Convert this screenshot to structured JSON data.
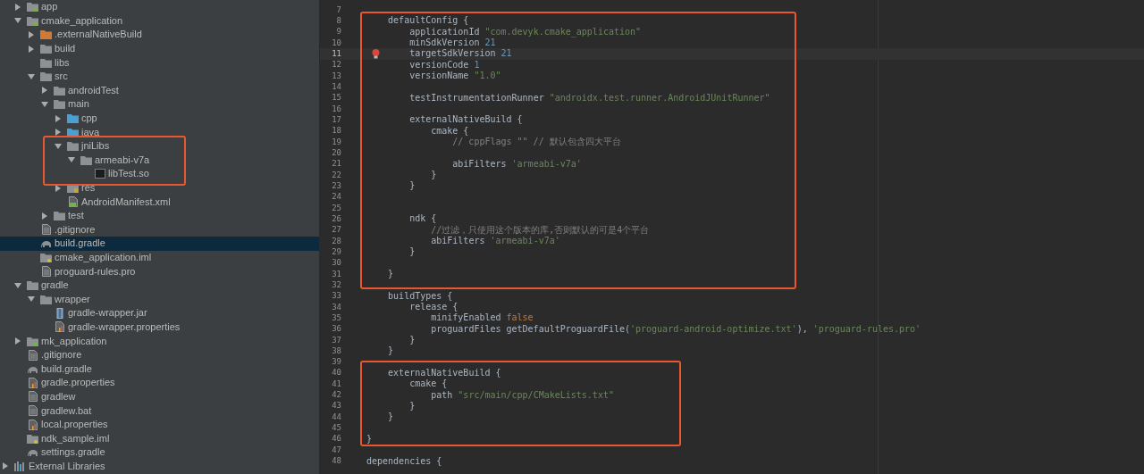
{
  "project_tree": [
    {
      "label": "app",
      "kind": "module",
      "expanded": false,
      "selected": false
    },
    {
      "label": "cmake_application",
      "kind": "module",
      "expanded": true,
      "selected": false,
      "children": [
        {
          "label": ".externalNativeBuild",
          "kind": "excluded-folder",
          "expanded": false,
          "selected": false
        },
        {
          "label": "build",
          "kind": "folder",
          "expanded": false,
          "selected": false
        },
        {
          "label": "libs",
          "kind": "folder",
          "selected": false
        },
        {
          "label": "src",
          "kind": "folder",
          "expanded": true,
          "selected": false,
          "children": [
            {
              "label": "androidTest",
              "kind": "folder",
              "expanded": false,
              "selected": false
            },
            {
              "label": "main",
              "kind": "folder",
              "expanded": true,
              "selected": false,
              "children": [
                {
                  "label": "cpp",
                  "kind": "source-folder",
                  "expanded": false,
                  "selected": false
                },
                {
                  "label": "java",
                  "kind": "source-folder",
                  "expanded": false,
                  "selected": false
                },
                {
                  "label": "jniLibs",
                  "kind": "folder",
                  "expanded": true,
                  "selected": false,
                  "children": [
                    {
                      "label": "armeabi-v7a",
                      "kind": "folder",
                      "expanded": true,
                      "selected": false,
                      "children": [
                        {
                          "label": "libTest.so",
                          "kind": "binary",
                          "selected": false
                        }
                      ]
                    }
                  ]
                },
                {
                  "label": "res",
                  "kind": "resource-folder",
                  "expanded": false,
                  "selected": false
                },
                {
                  "label": "AndroidManifest.xml",
                  "kind": "manifest",
                  "selected": false
                }
              ]
            },
            {
              "label": "test",
              "kind": "folder",
              "expanded": false,
              "selected": false
            }
          ]
        },
        {
          "label": ".gitignore",
          "kind": "file",
          "selected": false
        },
        {
          "label": "build.gradle",
          "kind": "gradle",
          "selected": true
        },
        {
          "label": "cmake_application.iml",
          "kind": "iml",
          "selected": false
        },
        {
          "label": "proguard-rules.pro",
          "kind": "file",
          "selected": false
        }
      ]
    },
    {
      "label": "gradle",
      "kind": "folder",
      "expanded": true,
      "selected": false,
      "children": [
        {
          "label": "wrapper",
          "kind": "folder",
          "expanded": true,
          "selected": false,
          "children": [
            {
              "label": "gradle-wrapper.jar",
              "kind": "jar",
              "selected": false
            },
            {
              "label": "gradle-wrapper.properties",
              "kind": "properties",
              "selected": false
            }
          ]
        }
      ]
    },
    {
      "label": "mk_application",
      "kind": "module",
      "expanded": false,
      "selected": false
    },
    {
      "label": ".gitignore",
      "kind": "file",
      "selected": false
    },
    {
      "label": "build.gradle",
      "kind": "gradle",
      "selected": false
    },
    {
      "label": "gradle.properties",
      "kind": "properties",
      "selected": false
    },
    {
      "label": "gradlew",
      "kind": "file",
      "selected": false
    },
    {
      "label": "gradlew.bat",
      "kind": "file",
      "selected": false
    },
    {
      "label": "local.properties",
      "kind": "properties",
      "selected": false
    },
    {
      "label": "ndk_sample.iml",
      "kind": "iml",
      "selected": false
    },
    {
      "label": "settings.gradle",
      "kind": "gradle",
      "selected": false
    },
    {
      "label": "External Libraries",
      "kind": "library",
      "expanded": false,
      "selected": false
    }
  ],
  "editor": {
    "lines": [
      {
        "number": "7",
        "current": false
      },
      {
        "number": "8",
        "current": false,
        "tokens": [
          {
            "text": "    defaultConfig {",
            "kind": "plain"
          }
        ]
      },
      {
        "number": "9",
        "current": false,
        "tokens": [
          {
            "text": "        applicationId ",
            "kind": "plain"
          },
          {
            "text": "\"com.devyk.cmake_application\"",
            "kind": "string"
          }
        ]
      },
      {
        "number": "10",
        "current": false,
        "tokens": [
          {
            "text": "        minSdkVersion ",
            "kind": "plain"
          },
          {
            "text": "21",
            "kind": "number"
          }
        ]
      },
      {
        "number": "11",
        "current": true,
        "tokens": [
          {
            "text": "        targetSdkVersion ",
            "kind": "plain"
          },
          {
            "text": "21",
            "kind": "number"
          }
        ]
      },
      {
        "number": "12",
        "current": false,
        "tokens": [
          {
            "text": "        versionCode ",
            "kind": "plain"
          },
          {
            "text": "1",
            "kind": "number"
          }
        ]
      },
      {
        "number": "13",
        "current": false,
        "tokens": [
          {
            "text": "        versionName ",
            "kind": "plain"
          },
          {
            "text": "\"1.0\"",
            "kind": "string"
          }
        ]
      },
      {
        "number": "14",
        "current": false
      },
      {
        "number": "15",
        "current": false,
        "tokens": [
          {
            "text": "        testInstrumentationRunner ",
            "kind": "plain"
          },
          {
            "text": "\"androidx.test.runner.AndroidJUnitRunner\"",
            "kind": "string"
          }
        ]
      },
      {
        "number": "16",
        "current": false
      },
      {
        "number": "17",
        "current": false,
        "tokens": [
          {
            "text": "        externalNativeBuild {",
            "kind": "plain"
          }
        ]
      },
      {
        "number": "18",
        "current": false,
        "tokens": [
          {
            "text": "            cmake {",
            "kind": "plain"
          }
        ]
      },
      {
        "number": "19",
        "current": false,
        "tokens": [
          {
            "text": "                // cppFlags \"\" // 默认包含四大平台",
            "kind": "comment"
          }
        ]
      },
      {
        "number": "20",
        "current": false
      },
      {
        "number": "21",
        "current": false,
        "tokens": [
          {
            "text": "                abiFilters ",
            "kind": "plain"
          },
          {
            "text": "'armeabi-v7a'",
            "kind": "string"
          }
        ]
      },
      {
        "number": "22",
        "current": false,
        "tokens": [
          {
            "text": "            }",
            "kind": "plain"
          }
        ]
      },
      {
        "number": "23",
        "current": false,
        "tokens": [
          {
            "text": "        }",
            "kind": "plain"
          }
        ]
      },
      {
        "number": "24",
        "current": false
      },
      {
        "number": "25",
        "current": false
      },
      {
        "number": "26",
        "current": false,
        "tokens": [
          {
            "text": "        ndk {",
            "kind": "plain"
          }
        ]
      },
      {
        "number": "27",
        "current": false,
        "tokens": [
          {
            "text": "            //过滤，只使用这个版本的库,否则默认的可是4个平台",
            "kind": "comment"
          }
        ]
      },
      {
        "number": "28",
        "current": false,
        "tokens": [
          {
            "text": "            abiFilters ",
            "kind": "plain"
          },
          {
            "text": "'armeabi-v7a'",
            "kind": "string"
          }
        ]
      },
      {
        "number": "29",
        "current": false,
        "tokens": [
          {
            "text": "        }",
            "kind": "plain"
          }
        ]
      },
      {
        "number": "30",
        "current": false
      },
      {
        "number": "31",
        "current": false,
        "tokens": [
          {
            "text": "    }",
            "kind": "plain"
          }
        ]
      },
      {
        "number": "32",
        "current": false
      },
      {
        "number": "33",
        "current": false,
        "tokens": [
          {
            "text": "    buildTypes {",
            "kind": "plain"
          }
        ]
      },
      {
        "number": "34",
        "current": false,
        "tokens": [
          {
            "text": "        release {",
            "kind": "plain"
          }
        ]
      },
      {
        "number": "35",
        "current": false,
        "tokens": [
          {
            "text": "            minifyEnabled ",
            "kind": "plain"
          },
          {
            "text": "false",
            "kind": "keyword"
          }
        ]
      },
      {
        "number": "36",
        "current": false,
        "tokens": [
          {
            "text": "            proguardFiles getDefaultProguardFile(",
            "kind": "plain"
          },
          {
            "text": "'proguard-android-optimize.txt'",
            "kind": "string"
          },
          {
            "text": "), ",
            "kind": "plain"
          },
          {
            "text": "'proguard-rules.pro'",
            "kind": "string"
          }
        ]
      },
      {
        "number": "37",
        "current": false,
        "tokens": [
          {
            "text": "        }",
            "kind": "plain"
          }
        ]
      },
      {
        "number": "38",
        "current": false,
        "tokens": [
          {
            "text": "    }",
            "kind": "plain"
          }
        ]
      },
      {
        "number": "39",
        "current": false
      },
      {
        "number": "40",
        "current": false,
        "tokens": [
          {
            "text": "    externalNativeBuild {",
            "kind": "plain"
          }
        ]
      },
      {
        "number": "41",
        "current": false,
        "tokens": [
          {
            "text": "        cmake {",
            "kind": "plain"
          }
        ]
      },
      {
        "number": "42",
        "current": false,
        "tokens": [
          {
            "text": "            path ",
            "kind": "plain"
          },
          {
            "text": "\"src/main/cpp/CMakeLists.txt\"",
            "kind": "string"
          }
        ]
      },
      {
        "number": "43",
        "current": false,
        "tokens": [
          {
            "text": "        }",
            "kind": "plain"
          }
        ]
      },
      {
        "number": "44",
        "current": false,
        "tokens": [
          {
            "text": "    }",
            "kind": "plain"
          }
        ]
      },
      {
        "number": "45",
        "current": false
      },
      {
        "number": "46",
        "current": false,
        "tokens": [
          {
            "text": "}",
            "kind": "plain"
          }
        ]
      },
      {
        "number": "47",
        "current": false
      },
      {
        "number": "48",
        "current": false,
        "tokens": [
          {
            "text": "dependencies {",
            "kind": "plain"
          }
        ]
      }
    ]
  }
}
